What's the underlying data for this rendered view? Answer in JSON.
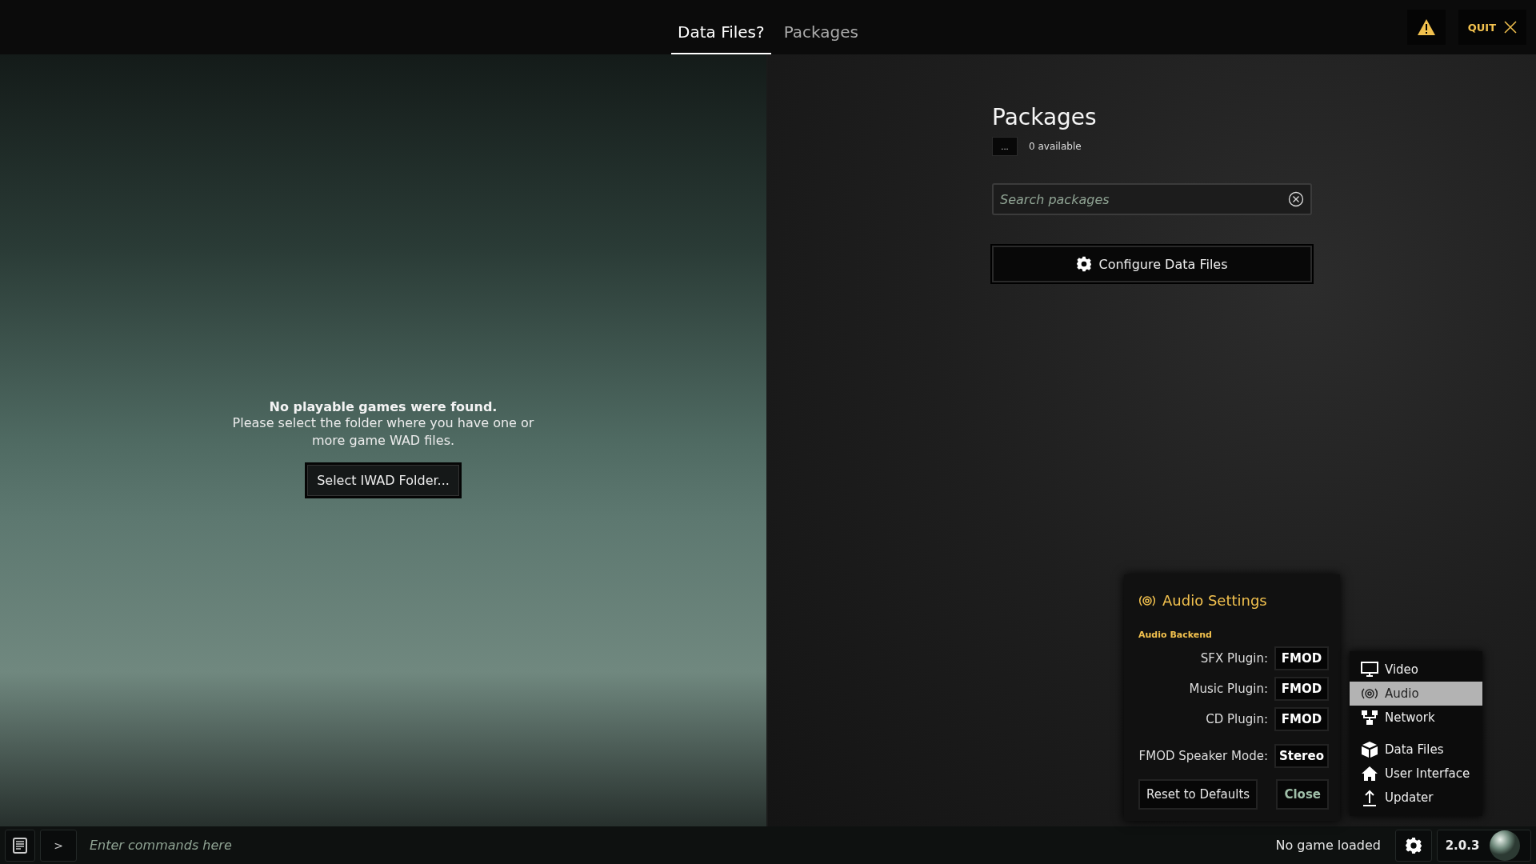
{
  "tabs": [
    {
      "label": "Data Files?",
      "selected": true
    },
    {
      "label": "Packages",
      "selected": false
    }
  ],
  "quit_button": "QUIT",
  "games": {
    "title": "No playable games were found.",
    "message": "Please select the folder where you have one or more game WAD files.",
    "button": "Select IWAD Folder..."
  },
  "packages": {
    "title": "Packages",
    "menu_button": "...",
    "count": "0 available",
    "search": {
      "placeholder": "Search packages"
    },
    "configure_button": "Configure Data Files"
  },
  "audio_settings": {
    "title": "Audio Settings",
    "section": "Audio Backend",
    "rows": [
      {
        "label": "SFX Plugin:",
        "value": "FMOD"
      },
      {
        "label": "Music Plugin:",
        "value": "FMOD"
      },
      {
        "label": "CD Plugin:",
        "value": "FMOD"
      },
      {
        "label": "FMOD Speaker Mode:",
        "value": "Stereo"
      }
    ],
    "buttons": [
      {
        "label": "Reset to Defaults",
        "kind": "default"
      },
      {
        "label": "Close",
        "kind": "accent"
      }
    ]
  },
  "settings_menu": {
    "groups": [
      [
        {
          "label": "Video",
          "selected": false
        },
        {
          "label": "Audio",
          "selected": true
        },
        {
          "label": "Network",
          "selected": false
        }
      ],
      [
        {
          "label": "Data Files",
          "selected": false
        },
        {
          "label": "User Interface",
          "selected": false
        },
        {
          "label": "Updater",
          "selected": false
        }
      ]
    ]
  },
  "status_bar": {
    "prompt": ">",
    "command": {
      "placeholder": "Enter commands here"
    },
    "status": "No game loaded",
    "version": "2.0.3"
  }
}
